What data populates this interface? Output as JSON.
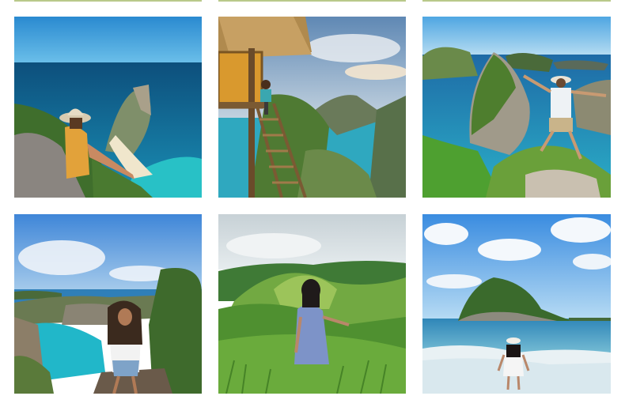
{
  "gallery": {
    "photos": [
      {
        "id": "kelingking-beach-woman-hat",
        "alt": ""
      },
      {
        "id": "treehouse-ladder-man",
        "alt": ""
      },
      {
        "id": "cliff-jump-man-hat",
        "alt": ""
      },
      {
        "id": "broken-beach-woman-curly-hair",
        "alt": ""
      },
      {
        "id": "green-hills-woman-blue-dress",
        "alt": ""
      },
      {
        "id": "beach-island-woman-white-dress",
        "alt": ""
      }
    ]
  },
  "colors": {
    "top_rule": "#b9c98a",
    "sea_deep": "#0f5b86",
    "sea_turquoise": "#22b5c7",
    "sky": "#4aa0e0",
    "grass": "#5f9a33"
  }
}
